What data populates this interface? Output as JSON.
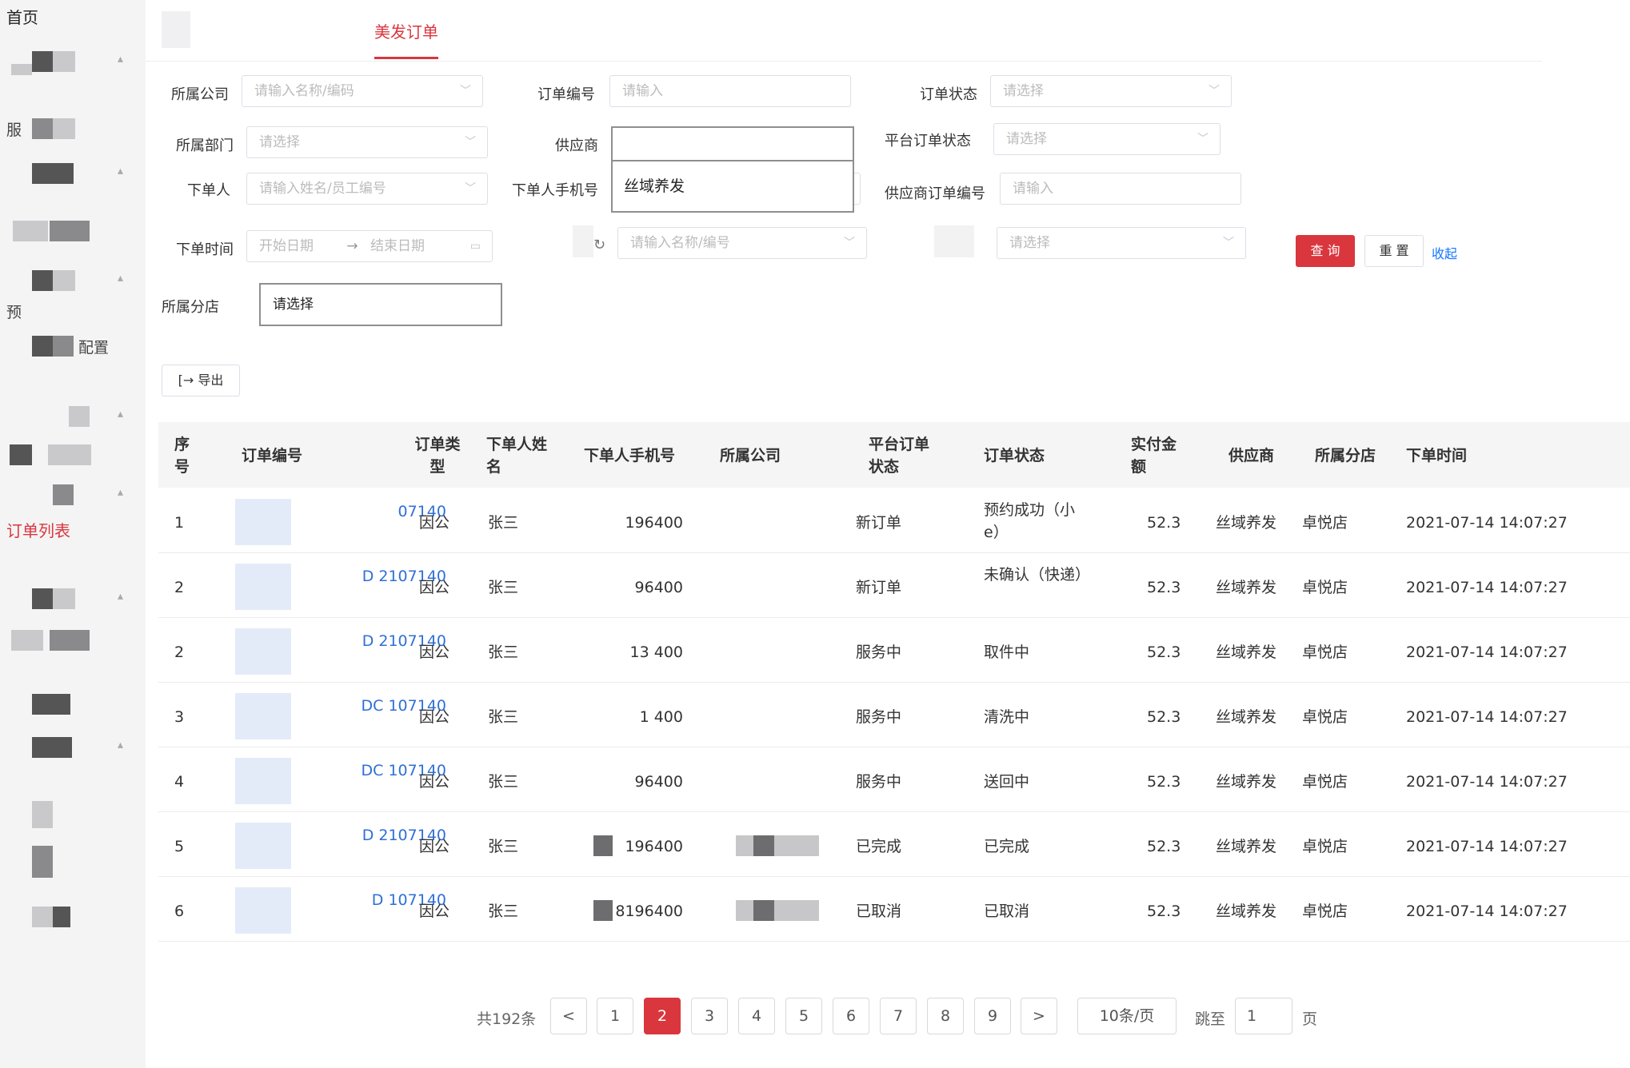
{
  "sidebar": {
    "home_label": "首页",
    "fragment_fu": "服",
    "fragment_yu": "预",
    "fragment_config": "配置",
    "active_item": "订单列表"
  },
  "tabs": {
    "active_label": "美发订单"
  },
  "filters": {
    "company": {
      "label": "所属公司",
      "placeholder": "请输入名称/编码"
    },
    "order_no": {
      "label": "订单编号",
      "placeholder": "请输入"
    },
    "order_status": {
      "label": "订单状态",
      "placeholder": "请选择"
    },
    "department": {
      "label": "所属部门",
      "placeholder": "请选择"
    },
    "supplier": {
      "label": "供应商",
      "value": "",
      "dropdown_option": "丝域养发"
    },
    "platform_status": {
      "label": "平台订单状态",
      "placeholder": "请选择"
    },
    "orderer": {
      "label": "下单人",
      "placeholder": "请输入姓名/员工编号"
    },
    "orderer_phone": {
      "label": "下单人手机号"
    },
    "supplier_order_no": {
      "label": "供应商订单编号",
      "placeholder": "请输入"
    },
    "order_time": {
      "label": "下单时间",
      "start_placeholder": "开始日期",
      "arrow": "→",
      "end_placeholder": "结束日期"
    },
    "unnamed_select_1": {
      "placeholder": "请输入名称/编号"
    },
    "unnamed_select_2": {
      "placeholder": "请选择"
    },
    "branch": {
      "label": "所属分店",
      "placeholder": "请选择"
    }
  },
  "actions": {
    "search_label": "查 询",
    "reset_label": "重 置",
    "collapse_label": "收起",
    "export_label": "导出",
    "export_icon": "[→"
  },
  "table": {
    "headers": {
      "seq": "序号",
      "order_no": "订单编号",
      "order_type": "订单类型",
      "orderer_name": "下单人姓名",
      "phone": "下单人手机号",
      "company": "所属公司",
      "platform_status": "平台订单状态",
      "order_status": "订单状态",
      "amount": "实付金额",
      "supplier": "供应商",
      "branch": "所属分店",
      "time": "下单时间"
    },
    "rows": [
      {
        "seq": "1",
        "order_no_a": "07140",
        "order_no_b": "",
        "type": "因公",
        "name": "张三",
        "phone": "196400",
        "platform_status": "新订单",
        "status": "预约成功（小e）",
        "amount": "52.3",
        "supplier": "丝域养发",
        "branch": "卓悦店",
        "time": "2021-07-14 14:07:27"
      },
      {
        "seq": "2",
        "order_no_a": "D        2107140",
        "order_no_b": "0",
        "type": "因公",
        "name": "张三",
        "phone": "96400",
        "platform_status": "新订单",
        "status": "未确认（快递）",
        "amount": "52.3",
        "supplier": "丝域养发",
        "branch": "卓悦店",
        "time": "2021-07-14 14:07:27"
      },
      {
        "seq": "2",
        "order_no_a": "D        2107140",
        "order_no_b": "00",
        "type": "因公",
        "name": "张三",
        "phone": "13        400",
        "platform_status": "服务中",
        "status": "取件中",
        "amount": "52.3",
        "supplier": "丝域养发",
        "branch": "卓悦店",
        "time": "2021-07-14 14:07:27"
      },
      {
        "seq": "3",
        "order_no_a": "DC        107140",
        "order_no_b": "00",
        "type": "因公",
        "name": "张三",
        "phone": "1        400",
        "platform_status": "服务中",
        "status": "清洗中",
        "amount": "52.3",
        "supplier": "丝域养发",
        "branch": "卓悦店",
        "time": "2021-07-14 14:07:27"
      },
      {
        "seq": "4",
        "order_no_a": "DC        107140",
        "order_no_b": "00",
        "type": "因公",
        "name": "张三",
        "phone": "96400",
        "platform_status": "服务中",
        "status": "送回中",
        "amount": "52.3",
        "supplier": "丝域养发",
        "branch": "卓悦店",
        "time": "2021-07-14 14:07:27"
      },
      {
        "seq": "5",
        "order_no_a": "D        2107140",
        "order_no_b": "",
        "type": "因公",
        "name": "张三",
        "phone": "196400",
        "platform_status": "已完成",
        "status": "已完成",
        "amount": "52.3",
        "supplier": "丝域养发",
        "branch": "卓悦店",
        "time": "2021-07-14 14:07:27"
      },
      {
        "seq": "6",
        "order_no_a": "D        107140",
        "order_no_b": "0",
        "type": "因公",
        "name": "张三",
        "phone": "8196400",
        "platform_status": "已取消",
        "status": "已取消",
        "amount": "52.3",
        "supplier": "丝域养发",
        "branch": "卓悦店",
        "time": "2021-07-14 14:07:27"
      }
    ]
  },
  "pagination": {
    "total": "共192条",
    "prev": "<",
    "next": ">",
    "pages": [
      "1",
      "2",
      "3",
      "4",
      "5",
      "6",
      "7",
      "8",
      "9"
    ],
    "active_page": "2",
    "page_size": "10条/页",
    "jump_label": "跳至",
    "jump_value": "1",
    "page_suffix": "页"
  },
  "colors": {
    "accent": "#d9363e",
    "link": "#2f6fd6"
  }
}
